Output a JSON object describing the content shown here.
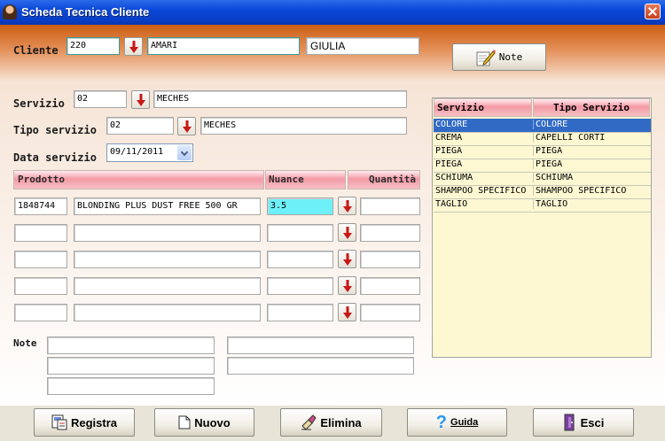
{
  "window": {
    "title": "Scheda Tecnica Cliente"
  },
  "client": {
    "label": "Cliente",
    "code": "220",
    "surname": "AMARI",
    "name": "GIULIA",
    "note_button": "Note"
  },
  "service": {
    "servizio_label": "Servizio",
    "servizio_code": "02",
    "servizio_name": "MECHES",
    "tipo_label": "Tipo servizio",
    "tipo_code": "02",
    "tipo_name": "MECHES",
    "data_label": "Data servizio",
    "data_value": "09/11/2011"
  },
  "products": {
    "headers": {
      "prodotto": "Prodotto",
      "nuance": "Nuance",
      "quantita": "Quantità"
    },
    "rows": [
      {
        "code": "1848744",
        "name": "BLONDING PLUS DUST FREE 500 GR",
        "nuance": "3.5",
        "qty": ""
      },
      {
        "code": "",
        "name": "",
        "nuance": "",
        "qty": ""
      },
      {
        "code": "",
        "name": "",
        "nuance": "",
        "qty": ""
      },
      {
        "code": "",
        "name": "",
        "nuance": "",
        "qty": ""
      },
      {
        "code": "",
        "name": "",
        "nuance": "",
        "qty": ""
      }
    ]
  },
  "notes": {
    "label": "Note"
  },
  "services_list": {
    "headers": {
      "servizio": "Servizio",
      "tipo": "Tipo Servizio"
    },
    "rows": [
      {
        "servizio": "COLORE",
        "tipo": "COLORE"
      },
      {
        "servizio": "CREMA",
        "tipo": "CAPELLI CORTI"
      },
      {
        "servizio": "PIEGA",
        "tipo": "PIEGA"
      },
      {
        "servizio": "PIEGA",
        "tipo": "PIEGA"
      },
      {
        "servizio": "SCHIUMA",
        "tipo": "SCHIUMA"
      },
      {
        "servizio": "SHAMPOO SPECIFICO",
        "tipo": "SHAMPOO SPECIFICO"
      },
      {
        "servizio": "TAGLIO",
        "tipo": "TAGLIO"
      }
    ]
  },
  "toolbar": {
    "registra": "Registra",
    "nuovo": "Nuovo",
    "elimina": "Elimina",
    "guida": "Guida",
    "esci": "Esci"
  },
  "colors": {
    "title_bar": "#0a47d8",
    "header_orange": "#cc5e14",
    "selection": "#316ac5",
    "nuance_highlight": "#6ef0f8",
    "list_bg": "#fdf8d2"
  },
  "icons": [
    "client-avatar-icon",
    "close-icon",
    "note-pencil-icon",
    "down-arrow-icon",
    "calendar-dropdown-icon",
    "save-icon",
    "new-document-icon",
    "eraser-icon",
    "help-icon",
    "exit-door-icon"
  ]
}
